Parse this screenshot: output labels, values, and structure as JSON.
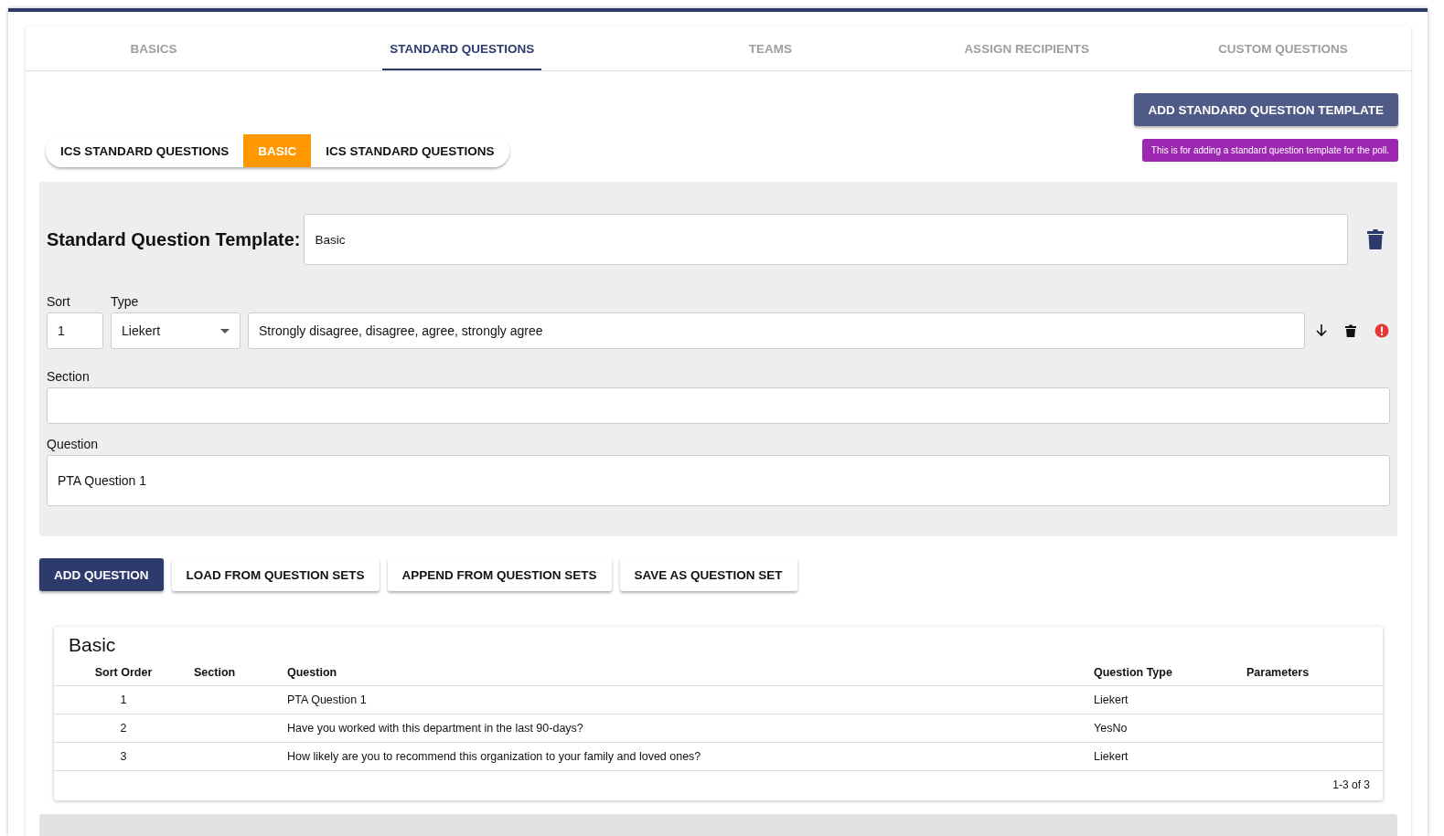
{
  "tabs": [
    {
      "label": "BASICS",
      "selected": false
    },
    {
      "label": "STANDARD QUESTIONS",
      "selected": true
    },
    {
      "label": "TEAMS",
      "selected": false
    },
    {
      "label": "ASSIGN RECIPIENTS",
      "selected": false
    },
    {
      "label": "CUSTOM QUESTIONS",
      "selected": false
    }
  ],
  "add_template_button": "ADD STANDARD QUESTION TEMPLATE",
  "tooltip": "This is for adding a standard question template for the poll.",
  "template_toggle": [
    {
      "label": "ICS STANDARD QUESTIONS",
      "selected": false
    },
    {
      "label": "BASIC",
      "selected": true
    },
    {
      "label": "ICS STANDARD QUESTIONS",
      "selected": false
    }
  ],
  "template_editor": {
    "label": "Standard Question Template:",
    "value": "Basic",
    "sort": {
      "label": "Sort",
      "value": "1"
    },
    "type": {
      "label": "Type",
      "value": "Liekert"
    },
    "options": {
      "value": "Strongly disagree, disagree, agree, strongly agree"
    },
    "section": {
      "label": "Section"
    },
    "question": {
      "label": "Question",
      "value": "PTA Question 1"
    }
  },
  "actions": [
    {
      "label": "ADD QUESTION",
      "kind": "primary"
    },
    {
      "label": "LOAD FROM QUESTION SETS",
      "kind": "secondary"
    },
    {
      "label": "APPEND FROM QUESTION SETS",
      "kind": "secondary"
    },
    {
      "label": "SAVE AS QUESTION SET",
      "kind": "secondary"
    }
  ],
  "table": {
    "title": "Basic",
    "columns": [
      "Sort Order",
      "Section",
      "Question",
      "Question Type",
      "Parameters"
    ],
    "rows": [
      [
        "1",
        "",
        "PTA Question 1",
        "Liekert",
        ""
      ],
      [
        "2",
        "",
        "Have you worked with this department in the last 90-days?",
        "YesNo",
        ""
      ],
      [
        "3",
        "",
        "How likely are you to recommend this organization to your family and loved ones?",
        "Liekert",
        ""
      ]
    ],
    "pagination": "1-3 of 3"
  }
}
